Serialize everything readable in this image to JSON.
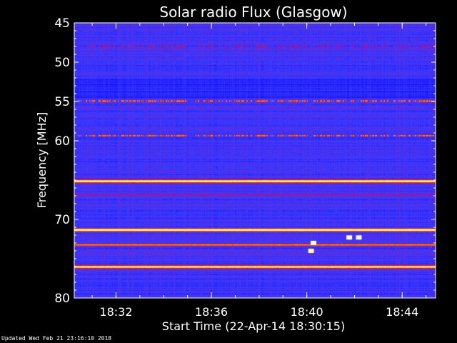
{
  "chart_data": {
    "type": "heatmap",
    "title": "Solar radio Flux (Glasgow)",
    "xlabel": "Start Time (22-Apr-14 18:30:15)",
    "ylabel": "Frequency [MHz]",
    "x_range_minutes": [
      0,
      15.15
    ],
    "x_ticks": [
      {
        "label": "18:32",
        "minutes": 1.75
      },
      {
        "label": "18:36",
        "minutes": 5.75
      },
      {
        "label": "18:40",
        "minutes": 9.75
      },
      {
        "label": "18:44",
        "minutes": 13.75
      }
    ],
    "ylim": [
      45,
      80
    ],
    "y_ticks": [
      45,
      50,
      55,
      60,
      70,
      80
    ],
    "y_tick_labels": [
      "45",
      "50",
      "55",
      "60",
      "70",
      "80"
    ],
    "colormap": [
      "#000080",
      "#1010ff",
      "#3a3aff",
      "#8020c0",
      "#d01020",
      "#ff6000",
      "#ffff60",
      "#ffffff"
    ],
    "emission_bands": [
      {
        "freq": 48.0,
        "intensity": 0.45,
        "width": 1.0,
        "dashed": true
      },
      {
        "freq": 49.5,
        "intensity": 0.35,
        "width": 0.5,
        "dashed": true
      },
      {
        "freq": 54.9,
        "intensity": 0.8,
        "width": 0.35,
        "dashed": true
      },
      {
        "freq": 59.3,
        "intensity": 0.8,
        "width": 0.3,
        "dashed": true
      },
      {
        "freq": 65.1,
        "intensity": 0.95,
        "width": 0.4,
        "dashed": false
      },
      {
        "freq": 66.8,
        "intensity": 0.5,
        "width": 0.3,
        "dashed": false
      },
      {
        "freq": 71.3,
        "intensity": 1.0,
        "width": 0.4,
        "dashed": false
      },
      {
        "freq": 73.2,
        "intensity": 0.8,
        "width": 0.3,
        "dashed": false
      },
      {
        "freq": 76.0,
        "intensity": 0.92,
        "width": 0.4,
        "dashed": false
      }
    ],
    "bursts": [
      {
        "minutes": 10.0,
        "freq": 73.0,
        "intensity": 1.0
      },
      {
        "minutes": 11.5,
        "freq": 72.3,
        "intensity": 1.0
      },
      {
        "minutes": 11.9,
        "freq": 72.3,
        "intensity": 1.0
      },
      {
        "minutes": 9.9,
        "freq": 74.0,
        "intensity": 0.9
      }
    ]
  },
  "footer": {
    "updated": "Updated Wed Feb 21 23:16:10 2018"
  }
}
